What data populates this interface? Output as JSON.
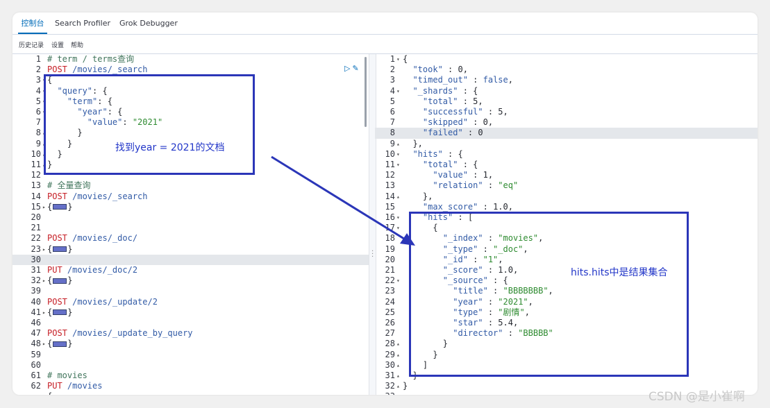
{
  "tabs": [
    "控制台",
    "Search Profiler",
    "Grok Debugger"
  ],
  "toolbar": [
    "历史记录",
    "设置",
    "帮助"
  ],
  "left_lines": [
    {
      "n": "1",
      "f": "",
      "t": [
        [
          "# term / terms查询",
          "comment"
        ]
      ]
    },
    {
      "n": "2",
      "f": "",
      "t": [
        [
          "POST",
          "method"
        ],
        [
          " /movies/_search",
          "url"
        ]
      ]
    },
    {
      "n": "3",
      "f": "▾",
      "t": [
        [
          "{",
          ""
        ]
      ]
    },
    {
      "n": "4",
      "f": "▾",
      "t": [
        [
          "  ",
          ""
        ],
        [
          "\"query\"",
          "key"
        ],
        [
          ": {",
          ""
        ]
      ]
    },
    {
      "n": "5",
      "f": "▾",
      "t": [
        [
          "    ",
          ""
        ],
        [
          "\"term\"",
          "key"
        ],
        [
          ": {",
          ""
        ]
      ]
    },
    {
      "n": "6",
      "f": "▾",
      "t": [
        [
          "      ",
          ""
        ],
        [
          "\"year\"",
          "key"
        ],
        [
          ": {",
          ""
        ]
      ]
    },
    {
      "n": "7",
      "f": "",
      "t": [
        [
          "        ",
          ""
        ],
        [
          "\"value\"",
          "key"
        ],
        [
          ": ",
          ""
        ],
        [
          "\"2021\"",
          "str"
        ]
      ]
    },
    {
      "n": "8",
      "f": "▴",
      "t": [
        [
          "      }",
          ""
        ]
      ]
    },
    {
      "n": "9",
      "f": "▴",
      "t": [
        [
          "    }",
          ""
        ]
      ]
    },
    {
      "n": "10",
      "f": "▴",
      "t": [
        [
          "  }",
          ""
        ]
      ]
    },
    {
      "n": "11",
      "f": "▴",
      "t": [
        [
          "}",
          ""
        ]
      ]
    },
    {
      "n": "12",
      "f": "",
      "t": []
    },
    {
      "n": "13",
      "f": "",
      "t": [
        [
          "# 全量查询",
          "comment"
        ]
      ]
    },
    {
      "n": "14",
      "f": "",
      "t": [
        [
          "POST",
          "method"
        ],
        [
          " /movies/_search",
          "url"
        ]
      ]
    },
    {
      "n": "15",
      "f": "▸",
      "t": [
        [
          "{",
          ""
        ],
        [
          "",
          "fold"
        ],
        [
          "}",
          ""
        ]
      ]
    },
    {
      "n": "20",
      "f": "",
      "t": []
    },
    {
      "n": "21",
      "f": "",
      "t": []
    },
    {
      "n": "22",
      "f": "",
      "t": [
        [
          "POST",
          "method"
        ],
        [
          " /movies/_doc/",
          "url"
        ]
      ]
    },
    {
      "n": "23",
      "f": "▸",
      "t": [
        [
          "{",
          ""
        ],
        [
          "",
          "fold"
        ],
        [
          "}",
          ""
        ]
      ]
    },
    {
      "n": "30",
      "f": "",
      "t": [
        [
          "",
          ""
        ]
      ],
      "hl": true
    },
    {
      "n": "31",
      "f": "",
      "t": [
        [
          "PUT",
          "method"
        ],
        [
          " /movies/_doc/2",
          "url"
        ]
      ]
    },
    {
      "n": "32",
      "f": "▸",
      "t": [
        [
          "{",
          ""
        ],
        [
          "",
          "fold"
        ],
        [
          "}",
          ""
        ]
      ]
    },
    {
      "n": "39",
      "f": "",
      "t": []
    },
    {
      "n": "40",
      "f": "",
      "t": [
        [
          "POST",
          "method"
        ],
        [
          " /movies/_update/2",
          "url"
        ]
      ]
    },
    {
      "n": "41",
      "f": "▸",
      "t": [
        [
          "{",
          ""
        ],
        [
          "",
          "fold"
        ],
        [
          "}",
          ""
        ]
      ]
    },
    {
      "n": "46",
      "f": "",
      "t": []
    },
    {
      "n": "47",
      "f": "",
      "t": [
        [
          "POST",
          "method"
        ],
        [
          " /movies/_update_by_query",
          "url"
        ]
      ]
    },
    {
      "n": "48",
      "f": "▸",
      "t": [
        [
          "{",
          ""
        ],
        [
          "",
          "fold"
        ],
        [
          "}",
          ""
        ]
      ]
    },
    {
      "n": "59",
      "f": "",
      "t": []
    },
    {
      "n": "60",
      "f": "",
      "t": []
    },
    {
      "n": "61",
      "f": "",
      "t": [
        [
          "# movies",
          "comment"
        ]
      ]
    },
    {
      "n": "62",
      "f": "",
      "t": [
        [
          "PUT",
          "method"
        ],
        [
          " /movies",
          "url"
        ]
      ]
    },
    {
      "n": "",
      "f": "",
      "t": [
        [
          "{",
          ""
        ]
      ]
    }
  ],
  "right_lines": [
    {
      "n": "1",
      "f": "▾",
      "t": [
        [
          "{",
          ""
        ]
      ]
    },
    {
      "n": "2",
      "f": "",
      "t": [
        [
          "  ",
          ""
        ],
        [
          "\"took\"",
          "key"
        ],
        [
          " : ",
          ""
        ],
        [
          "0",
          "num"
        ],
        [
          ",",
          ""
        ]
      ]
    },
    {
      "n": "3",
      "f": "",
      "t": [
        [
          "  ",
          ""
        ],
        [
          "\"timed_out\"",
          "key"
        ],
        [
          " : ",
          ""
        ],
        [
          "false",
          "bool"
        ],
        [
          ",",
          ""
        ]
      ]
    },
    {
      "n": "4",
      "f": "▾",
      "t": [
        [
          "  ",
          ""
        ],
        [
          "\"_shards\"",
          "key"
        ],
        [
          " : {",
          ""
        ]
      ]
    },
    {
      "n": "5",
      "f": "",
      "t": [
        [
          "    ",
          ""
        ],
        [
          "\"total\"",
          "key"
        ],
        [
          " : ",
          ""
        ],
        [
          "5",
          "num"
        ],
        [
          ",",
          ""
        ]
      ]
    },
    {
      "n": "6",
      "f": "",
      "t": [
        [
          "    ",
          ""
        ],
        [
          "\"successful\"",
          "key"
        ],
        [
          " : ",
          ""
        ],
        [
          "5",
          "num"
        ],
        [
          ",",
          ""
        ]
      ]
    },
    {
      "n": "7",
      "f": "",
      "t": [
        [
          "    ",
          ""
        ],
        [
          "\"skipped\"",
          "key"
        ],
        [
          " : ",
          ""
        ],
        [
          "0",
          "num"
        ],
        [
          ",",
          ""
        ]
      ]
    },
    {
      "n": "8",
      "f": "",
      "t": [
        [
          "    ",
          ""
        ],
        [
          "\"failed\"",
          "key"
        ],
        [
          " : ",
          ""
        ],
        [
          "0",
          "num"
        ]
      ],
      "hl": true
    },
    {
      "n": "9",
      "f": "▴",
      "t": [
        [
          "  },",
          ""
        ]
      ]
    },
    {
      "n": "10",
      "f": "▾",
      "t": [
        [
          "  ",
          ""
        ],
        [
          "\"hits\"",
          "key"
        ],
        [
          " : {",
          ""
        ]
      ]
    },
    {
      "n": "11",
      "f": "▾",
      "t": [
        [
          "    ",
          ""
        ],
        [
          "\"total\"",
          "key"
        ],
        [
          " : {",
          ""
        ]
      ]
    },
    {
      "n": "12",
      "f": "",
      "t": [
        [
          "      ",
          ""
        ],
        [
          "\"value\"",
          "key"
        ],
        [
          " : ",
          ""
        ],
        [
          "1",
          "num"
        ],
        [
          ",",
          ""
        ]
      ]
    },
    {
      "n": "13",
      "f": "",
      "t": [
        [
          "      ",
          ""
        ],
        [
          "\"relation\"",
          "key"
        ],
        [
          " : ",
          ""
        ],
        [
          "\"eq\"",
          "str"
        ]
      ]
    },
    {
      "n": "14",
      "f": "▴",
      "t": [
        [
          "    },",
          ""
        ]
      ]
    },
    {
      "n": "15",
      "f": "",
      "t": [
        [
          "    ",
          ""
        ],
        [
          "\"max_score\"",
          "key"
        ],
        [
          " : ",
          ""
        ],
        [
          "1.0",
          "num"
        ],
        [
          ",",
          ""
        ]
      ]
    },
    {
      "n": "16",
      "f": "▾",
      "t": [
        [
          "    ",
          ""
        ],
        [
          "\"hits\"",
          "key"
        ],
        [
          " : [",
          ""
        ]
      ]
    },
    {
      "n": "17",
      "f": "▾",
      "t": [
        [
          "      {",
          ""
        ]
      ]
    },
    {
      "n": "18",
      "f": "",
      "t": [
        [
          "        ",
          ""
        ],
        [
          "\"_index\"",
          "key"
        ],
        [
          " : ",
          ""
        ],
        [
          "\"movies\"",
          "str"
        ],
        [
          ",",
          ""
        ]
      ]
    },
    {
      "n": "19",
      "f": "",
      "t": [
        [
          "        ",
          ""
        ],
        [
          "\"_type\"",
          "key"
        ],
        [
          " : ",
          ""
        ],
        [
          "\"_doc\"",
          "str"
        ],
        [
          ",",
          ""
        ]
      ]
    },
    {
      "n": "20",
      "f": "",
      "t": [
        [
          "        ",
          ""
        ],
        [
          "\"_id\"",
          "key"
        ],
        [
          " : ",
          ""
        ],
        [
          "\"1\"",
          "str"
        ],
        [
          ",",
          ""
        ]
      ]
    },
    {
      "n": "21",
      "f": "",
      "t": [
        [
          "        ",
          ""
        ],
        [
          "\"_score\"",
          "key"
        ],
        [
          " : ",
          ""
        ],
        [
          "1.0",
          "num"
        ],
        [
          ",",
          ""
        ]
      ]
    },
    {
      "n": "22",
      "f": "▾",
      "t": [
        [
          "        ",
          ""
        ],
        [
          "\"_source\"",
          "key"
        ],
        [
          " : {",
          ""
        ]
      ]
    },
    {
      "n": "23",
      "f": "",
      "t": [
        [
          "          ",
          ""
        ],
        [
          "\"title\"",
          "key"
        ],
        [
          " : ",
          ""
        ],
        [
          "\"BBBBBBB\"",
          "str"
        ],
        [
          ",",
          ""
        ]
      ]
    },
    {
      "n": "24",
      "f": "",
      "t": [
        [
          "          ",
          ""
        ],
        [
          "\"year\"",
          "key"
        ],
        [
          " : ",
          ""
        ],
        [
          "\"2021\"",
          "str"
        ],
        [
          ",",
          ""
        ]
      ]
    },
    {
      "n": "25",
      "f": "",
      "t": [
        [
          "          ",
          ""
        ],
        [
          "\"type\"",
          "key"
        ],
        [
          " : ",
          ""
        ],
        [
          "\"剧情\"",
          "str"
        ],
        [
          ",",
          ""
        ]
      ]
    },
    {
      "n": "26",
      "f": "",
      "t": [
        [
          "          ",
          ""
        ],
        [
          "\"star\"",
          "key"
        ],
        [
          " : ",
          ""
        ],
        [
          "5.4",
          "num"
        ],
        [
          ",",
          ""
        ]
      ]
    },
    {
      "n": "27",
      "f": "",
      "t": [
        [
          "          ",
          ""
        ],
        [
          "\"director\"",
          "key"
        ],
        [
          " : ",
          ""
        ],
        [
          "\"BBBBB\"",
          "str"
        ]
      ]
    },
    {
      "n": "28",
      "f": "▴",
      "t": [
        [
          "        }",
          ""
        ]
      ]
    },
    {
      "n": "29",
      "f": "▴",
      "t": [
        [
          "      }",
          ""
        ]
      ]
    },
    {
      "n": "30",
      "f": "▴",
      "t": [
        [
          "    ]",
          ""
        ]
      ]
    },
    {
      "n": "31",
      "f": "▴",
      "t": [
        [
          "  }",
          ""
        ]
      ]
    },
    {
      "n": "32",
      "f": "▴",
      "t": [
        [
          "}",
          ""
        ]
      ]
    },
    {
      "n": "33",
      "f": "",
      "t": []
    }
  ],
  "annotations": {
    "left_note": "找到year = 2021的文档",
    "right_note": "hits.hits中是结果集合",
    "color": "#2b36b8"
  },
  "action_icons": [
    "play-icon",
    "wrench-icon"
  ],
  "watermark": "CSDN @是小崔啊"
}
